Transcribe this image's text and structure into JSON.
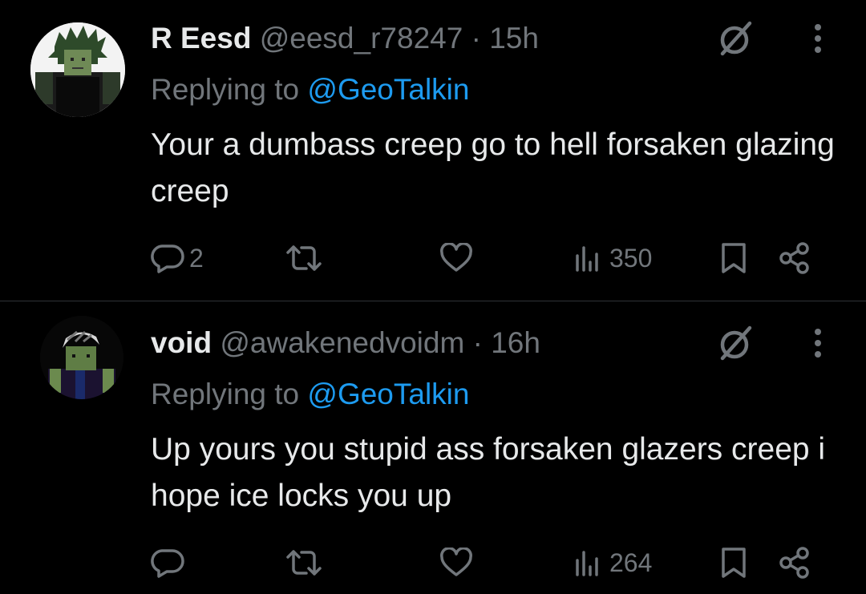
{
  "posts": [
    {
      "author_name": "R Eesd",
      "handle": "@eesd_r78247",
      "separator": "·",
      "time": "15h",
      "replying_prefix": "Replying to",
      "replying_to": "@GeoTalkin",
      "text": "Your a dumbass creep go to hell forsaken glazing creep",
      "reply_count": "2",
      "repost_count": "",
      "like_count": "",
      "view_count": "350",
      "avatar_icon": "roblox-avatar-green-hair-icon"
    },
    {
      "author_name": "void",
      "handle": "@awakenedvoidm",
      "separator": "·",
      "time": "16h",
      "replying_prefix": "Replying to",
      "replying_to": "@GeoTalkin",
      "text": "Up yours you stupid ass forsaken glazers creep i hope ice locks you up",
      "reply_count": "",
      "repost_count": "",
      "like_count": "",
      "view_count": "264",
      "avatar_icon": "roblox-avatar-helmet-icon"
    }
  ],
  "colors": {
    "background": "#000000",
    "primary_text": "#e7e9ea",
    "secondary_text": "#71767b",
    "link": "#1d9bf0",
    "divider": "#2f3336"
  }
}
